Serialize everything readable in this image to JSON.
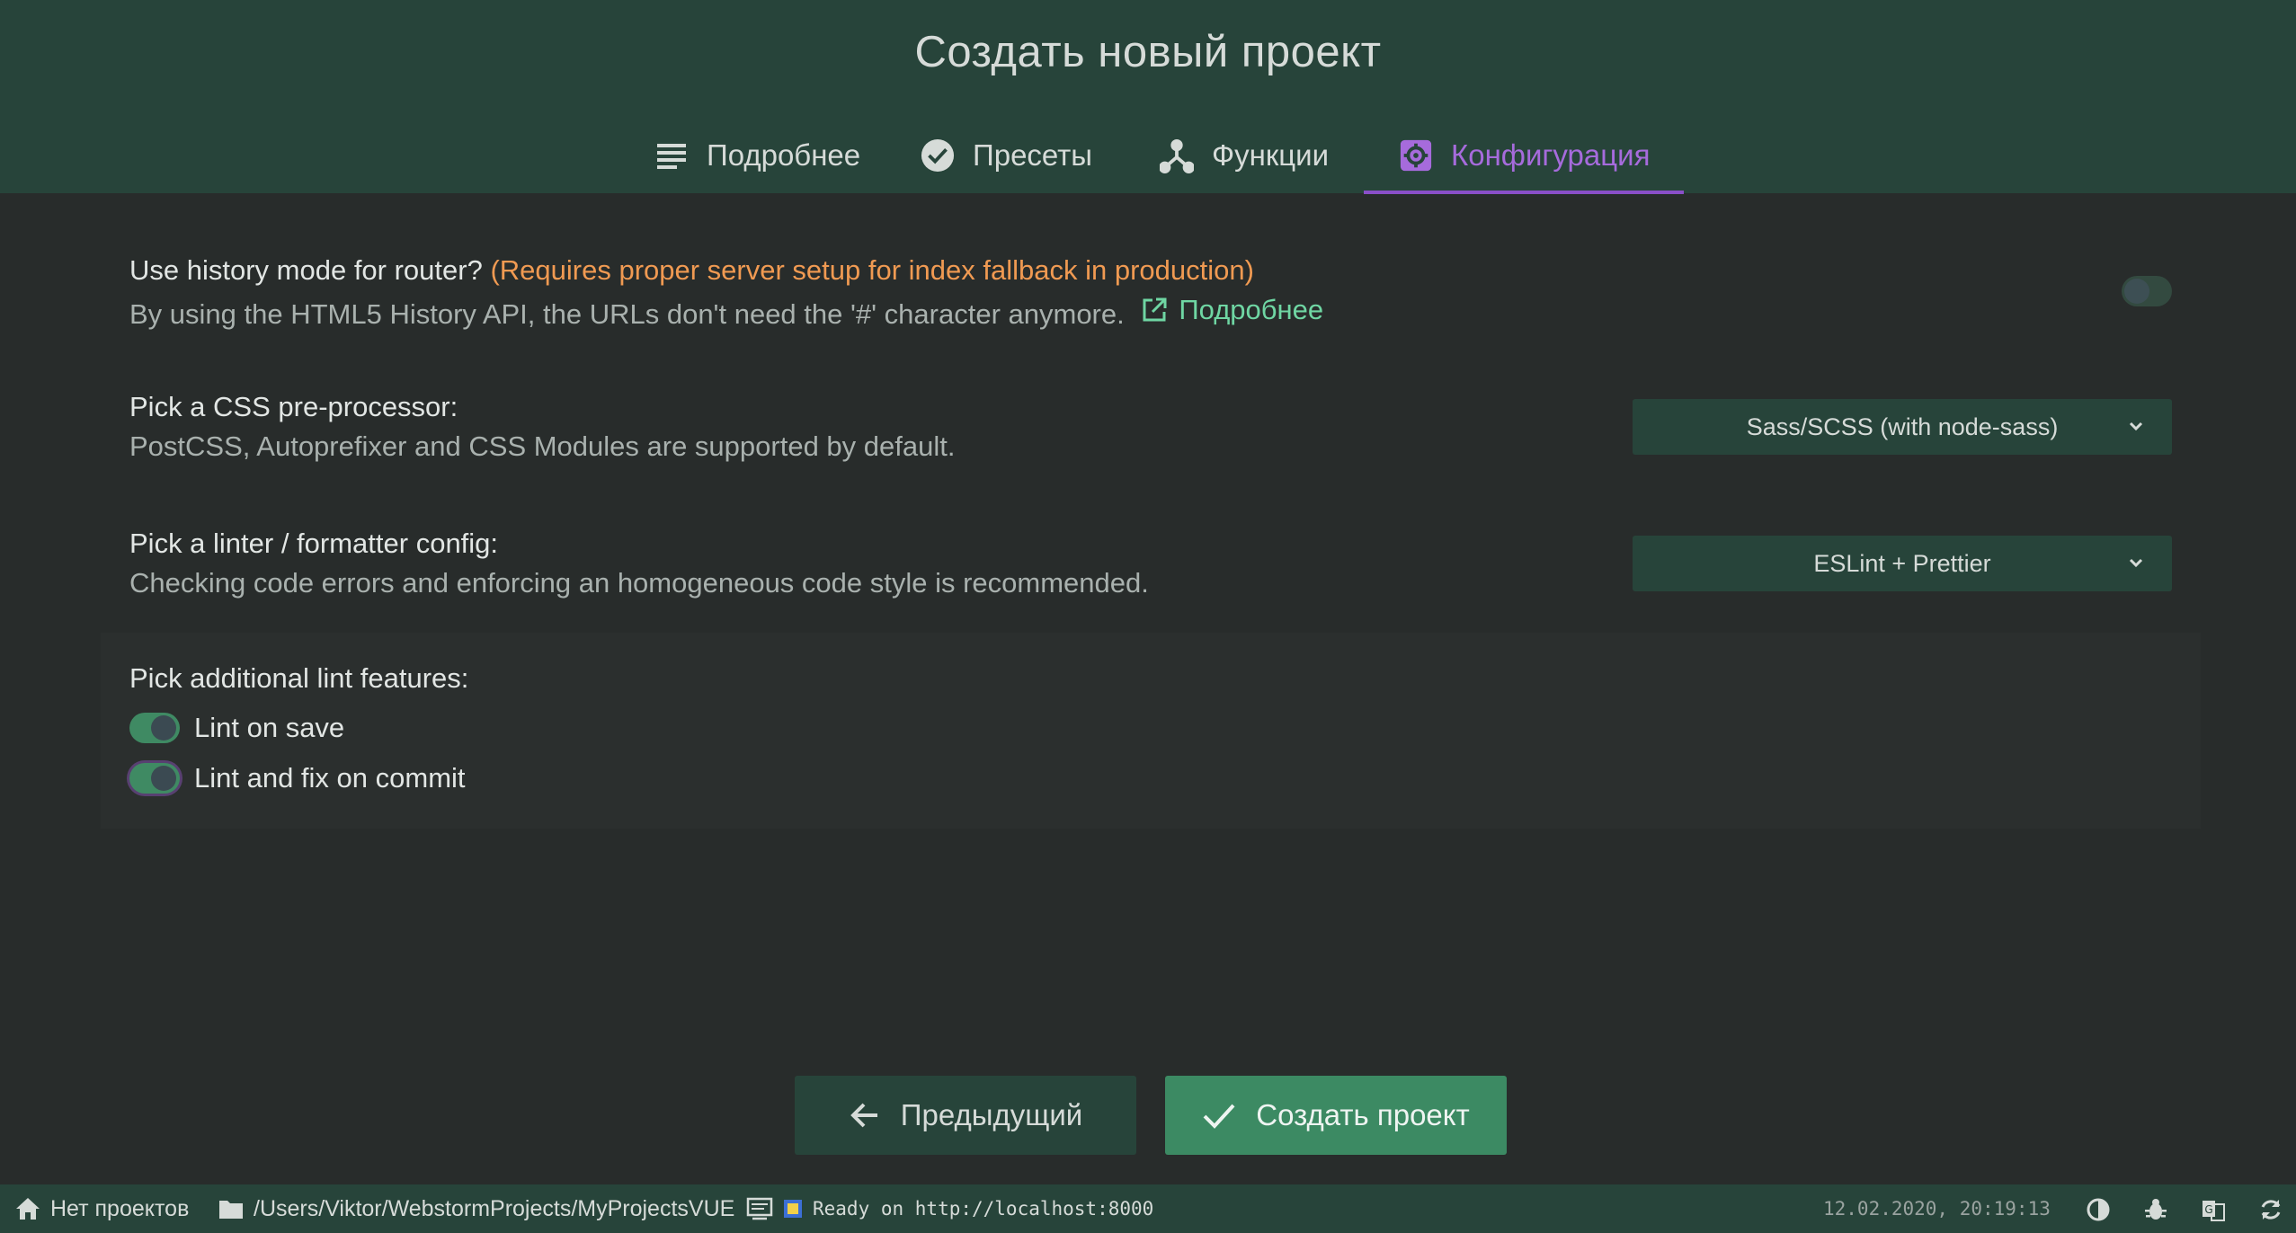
{
  "header": {
    "title": "Создать новый проект",
    "tabs": [
      {
        "label": "Подробнее",
        "icon": "details-list-icon",
        "active": false
      },
      {
        "label": "Пресеты",
        "icon": "check-circle-icon",
        "active": false
      },
      {
        "label": "Функции",
        "icon": "fork-icon",
        "active": false
      },
      {
        "label": "Конфигурация",
        "icon": "settings-cog-icon",
        "active": true
      }
    ],
    "accent": "#a66bdc"
  },
  "history": {
    "question": "Use history mode for router?",
    "warning": "(Requires proper server setup for index fallback in production)",
    "description": "By using the HTML5 History API, the URLs don't need the '#' character anymore.",
    "link": "Подробнее",
    "enabled": false
  },
  "css": {
    "label": "Pick a CSS pre-processor:",
    "description": "PostCSS, Autoprefixer and CSS Modules are supported by default.",
    "selected": "Sass/SCSS (with node-sass)"
  },
  "linter": {
    "label": "Pick a linter / formatter config:",
    "description": "Checking code errors and enforcing an homogeneous code style is recommended.",
    "selected": "ESLint + Prettier"
  },
  "lint_features": {
    "label": "Pick additional lint features:",
    "items": [
      {
        "label": "Lint on save",
        "enabled": true
      },
      {
        "label": "Lint and fix on commit",
        "enabled": true
      }
    ]
  },
  "buttons": {
    "prev": "Предыдущий",
    "create": "Создать проект"
  },
  "statusbar": {
    "projects": "Нет проектов",
    "path": "/Users/Viktor/WebstormProjects/MyProjectsVUE",
    "log": "Ready on http://localhost:8000",
    "datetime": "12.02.2020, 20:19:13"
  },
  "colors": {
    "header_bg": "#27443a",
    "body_bg": "#282c2b",
    "primary": "#3c8a63",
    "warning": "#f09a52",
    "link": "#6fd6a3"
  }
}
